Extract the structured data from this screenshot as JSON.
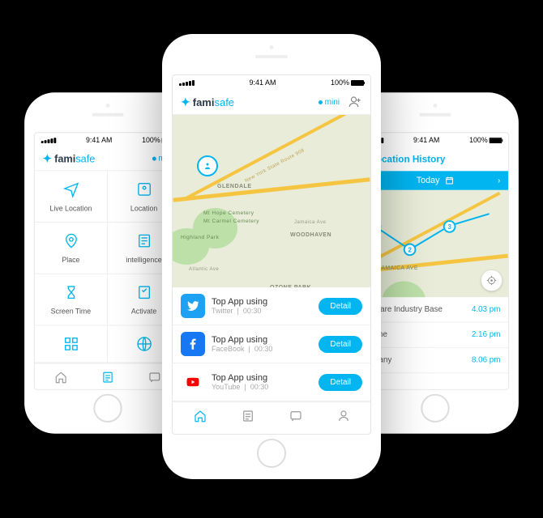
{
  "status": {
    "time": "9:41 AM",
    "battery": "100%"
  },
  "brand": {
    "part1": "fami",
    "part2": "safe"
  },
  "left": {
    "profile": "mini",
    "grid": [
      {
        "label": "Live Location"
      },
      {
        "label": "Location"
      },
      {
        "label": "Place"
      },
      {
        "label": "intelligence"
      },
      {
        "label": "Screen Time"
      },
      {
        "label": "Activate"
      }
    ]
  },
  "center": {
    "profile": "mini",
    "map": {
      "labels": {
        "glendale": "GLENDALE",
        "woodhaven": "WOODHAVEN",
        "ozone": "OZONE PARK",
        "cemetery1": "Mt Hope Cemetery",
        "cemetery2": "Mt Carmel Cemetery",
        "highland": "Highland Park",
        "route": "New York State Route 908",
        "jamaica": "Jamaica Ave",
        "atlantic": "Atlantic Ave"
      }
    },
    "apps": [
      {
        "title": "Top App using",
        "name": "Twitter",
        "time": "00:30",
        "btn": "Detail"
      },
      {
        "title": "Top App using",
        "name": "FaceBook",
        "time": "00:30",
        "btn": "Detail"
      },
      {
        "title": "Top App using",
        "name": "YouTube",
        "time": "00:30",
        "btn": "Detail"
      }
    ]
  },
  "right": {
    "title": "Location History",
    "date": "Today",
    "history": [
      {
        "place": "ftware Industry Base",
        "time": "4.03 pm"
      },
      {
        "place": "kone",
        "time": "2.16 pm"
      },
      {
        "place": "npany",
        "time": "8.06 pm"
      }
    ]
  }
}
